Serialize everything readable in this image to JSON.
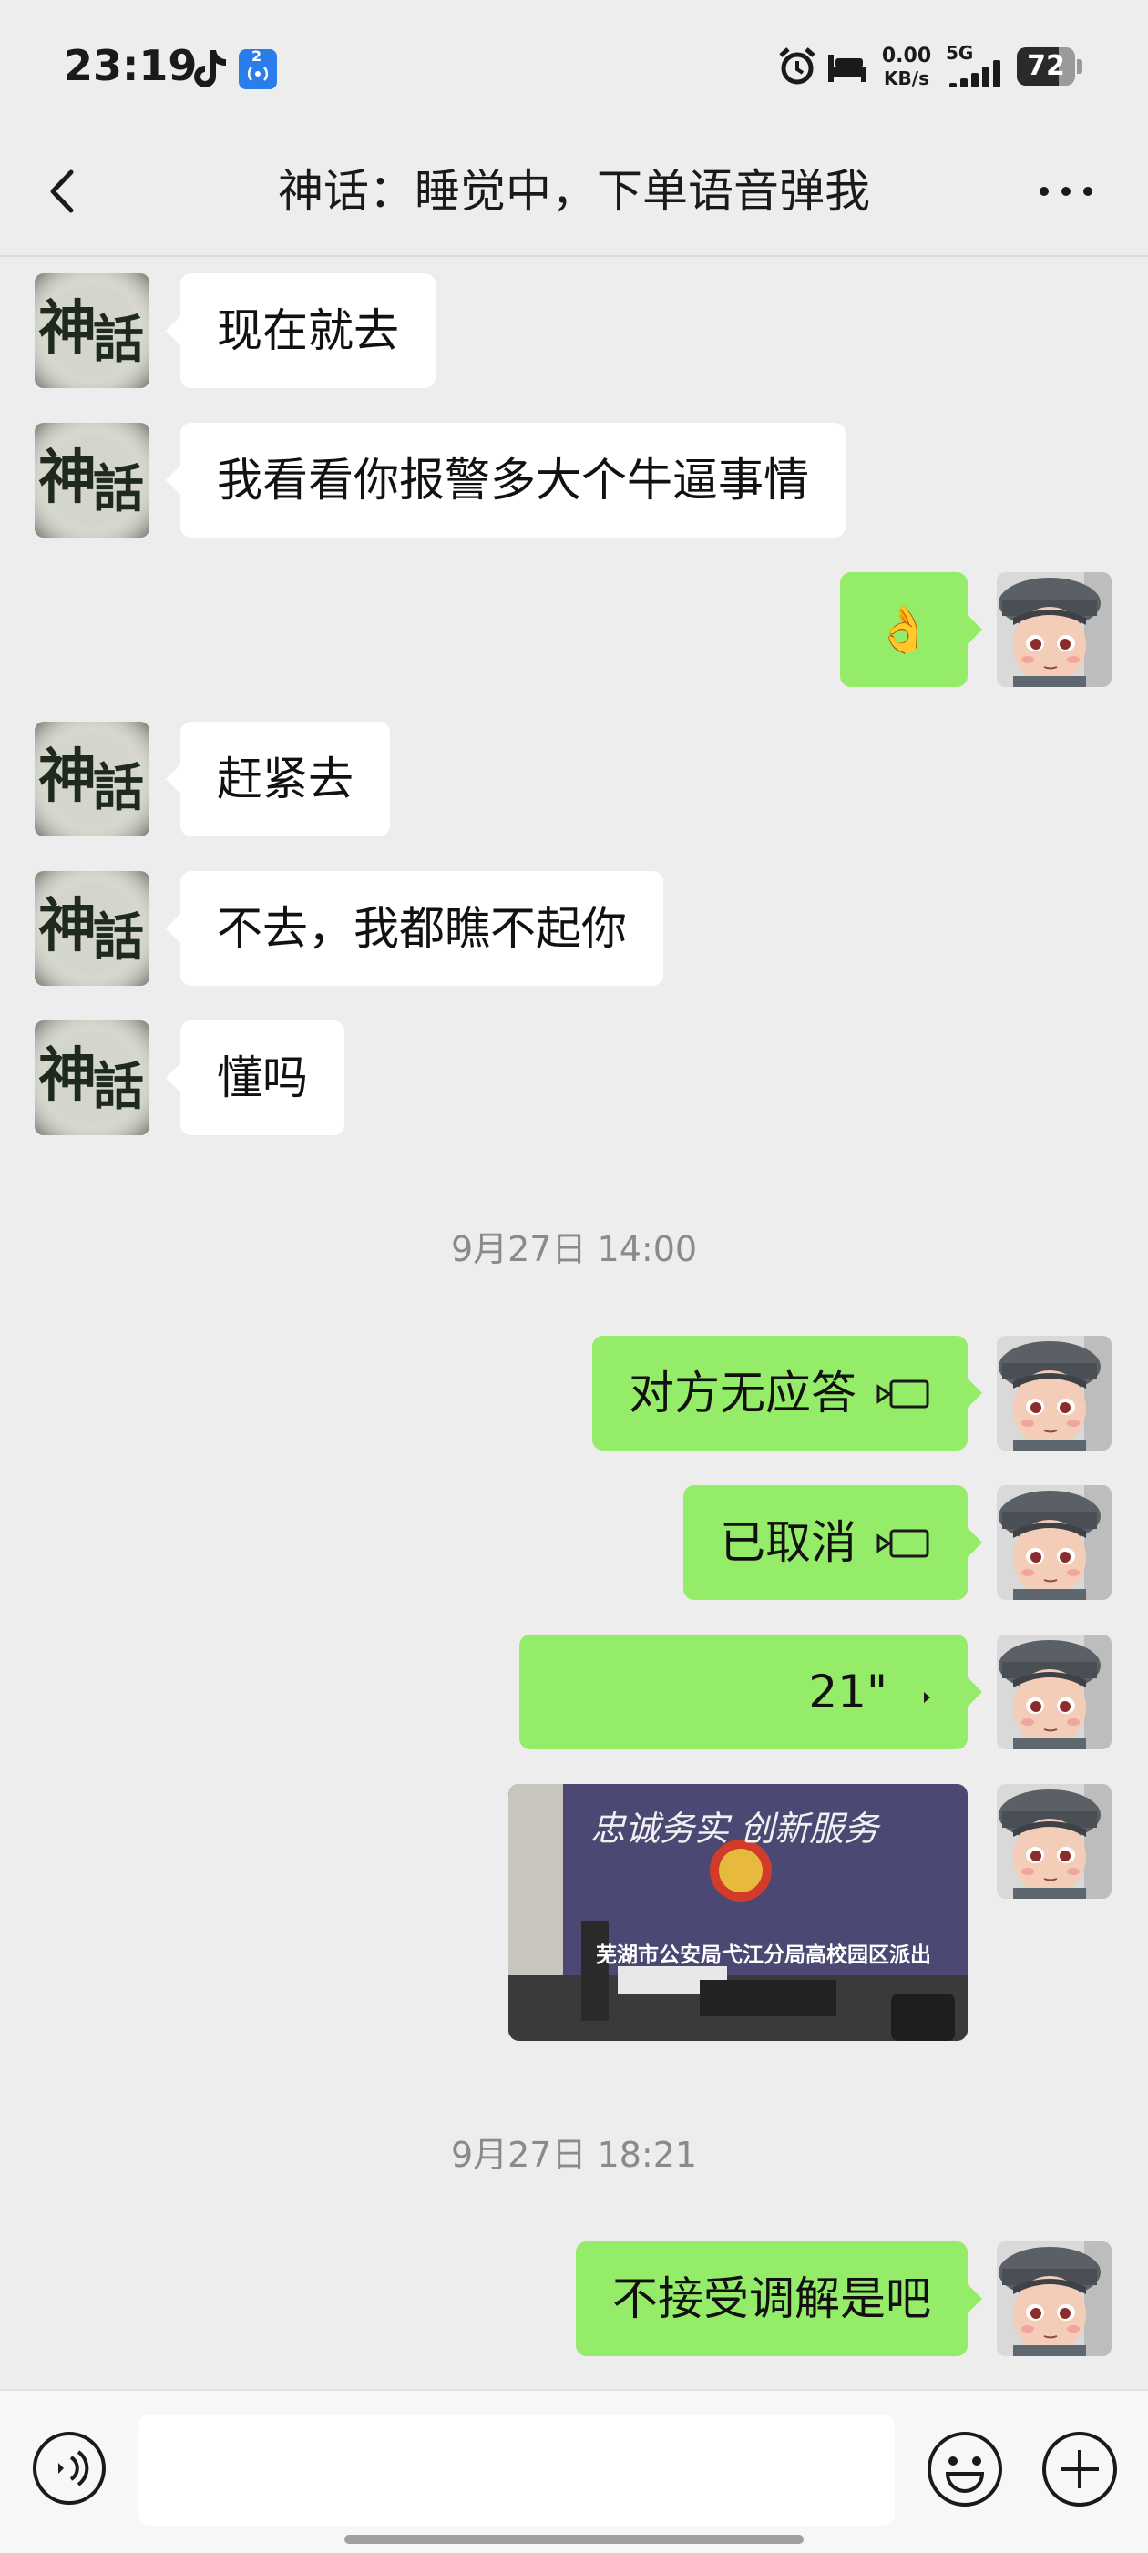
{
  "status_bar": {
    "time": "23:19",
    "net_speed_value": "0.00",
    "net_speed_unit": "KB/s",
    "network": "5G",
    "battery": "72",
    "notif_badge": "2",
    "icons": [
      "tiktok-icon",
      "wireless-broadcast-icon",
      "alarm-icon",
      "bed-icon",
      "signal-icon",
      "battery-icon"
    ]
  },
  "header": {
    "title": "神话：睡觉中，下单语音弹我"
  },
  "messages": [
    {
      "side": "left",
      "type": "text",
      "text": "现在就去"
    },
    {
      "side": "left",
      "type": "text",
      "text": "我看看你报警多大个牛逼事情"
    },
    {
      "side": "right",
      "type": "emoji",
      "text": "👌"
    },
    {
      "side": "left",
      "type": "text",
      "text": "赶紧去"
    },
    {
      "side": "left",
      "type": "text",
      "text": "不去，我都瞧不起你"
    },
    {
      "side": "left",
      "type": "text",
      "text": "懂吗"
    },
    {
      "type": "timestamp",
      "text": "9月27日 14:00"
    },
    {
      "side": "right",
      "type": "call",
      "text": "对方无应答"
    },
    {
      "side": "right",
      "type": "call",
      "text": "已取消"
    },
    {
      "side": "right",
      "type": "voice",
      "text": "21\""
    },
    {
      "side": "right",
      "type": "image",
      "caption_top": "忠诚务实 创新服务",
      "caption_bottom": "芜湖市公安局弋江分局高校园区派出"
    },
    {
      "type": "timestamp",
      "text": "9月27日 18:21"
    },
    {
      "side": "right",
      "type": "text",
      "text": "不接受调解是吧"
    }
  ],
  "input_bar": {
    "placeholder": "",
    "icons": [
      "voice-input-icon",
      "emoji-icon",
      "plus-icon"
    ]
  },
  "colors": {
    "background": "#ededed",
    "sent_bubble": "#95ec69",
    "received_bubble": "#ffffff"
  }
}
